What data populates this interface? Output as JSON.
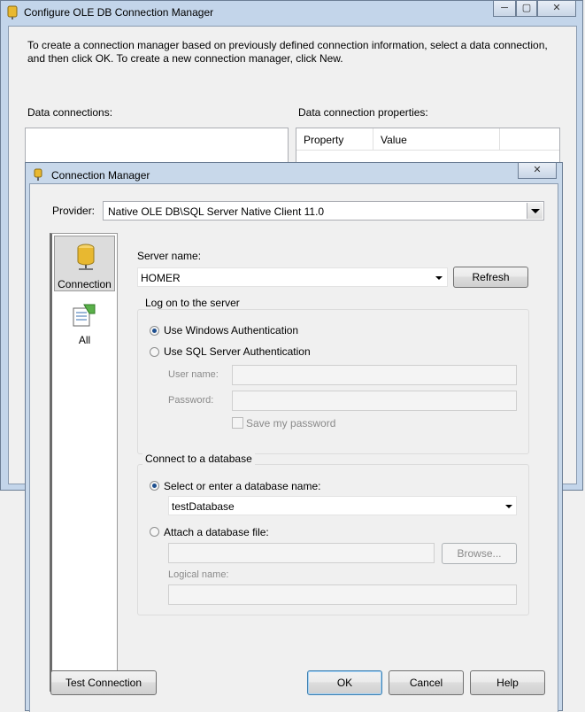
{
  "outer_dialog": {
    "title": "Configure OLE DB Connection Manager",
    "intro": "To create a connection manager based on previously defined connection information, select a data connection, and then click OK. To create a new connection manager, click New.",
    "data_connections_label": "Data connections:",
    "properties_label": "Data connection properties:",
    "columns": [
      "Property",
      "Value"
    ]
  },
  "dialog": {
    "title": "Connection Manager",
    "provider_label": "Provider:",
    "provider_value": "Native OLE DB\\SQL Server Native Client 11.0",
    "nav": [
      {
        "label": "Connection",
        "icon": "database-icon",
        "selected": true
      },
      {
        "label": "All",
        "icon": "all-properties-icon",
        "selected": false
      }
    ],
    "server_name_label": "Server name:",
    "server_name_value": "HOMER",
    "refresh_label": "Refresh",
    "logon_group": {
      "title": "Log on to the server",
      "windows_auth": "Use Windows Authentication",
      "sql_auth": "Use SQL Server Authentication",
      "selected": "windows",
      "user_name_label": "User name:",
      "password_label": "Password:",
      "save_password_label": "Save my password"
    },
    "database_group": {
      "title": "Connect to a database",
      "select_db_label": "Select or enter a database name:",
      "db_value": "testDatabase",
      "attach_label": "Attach a database file:",
      "browse_label": "Browse...",
      "logical_name_label": "Logical name:",
      "selected": "select"
    },
    "buttons": {
      "test": "Test Connection",
      "ok": "OK",
      "cancel": "Cancel",
      "help": "Help"
    }
  }
}
